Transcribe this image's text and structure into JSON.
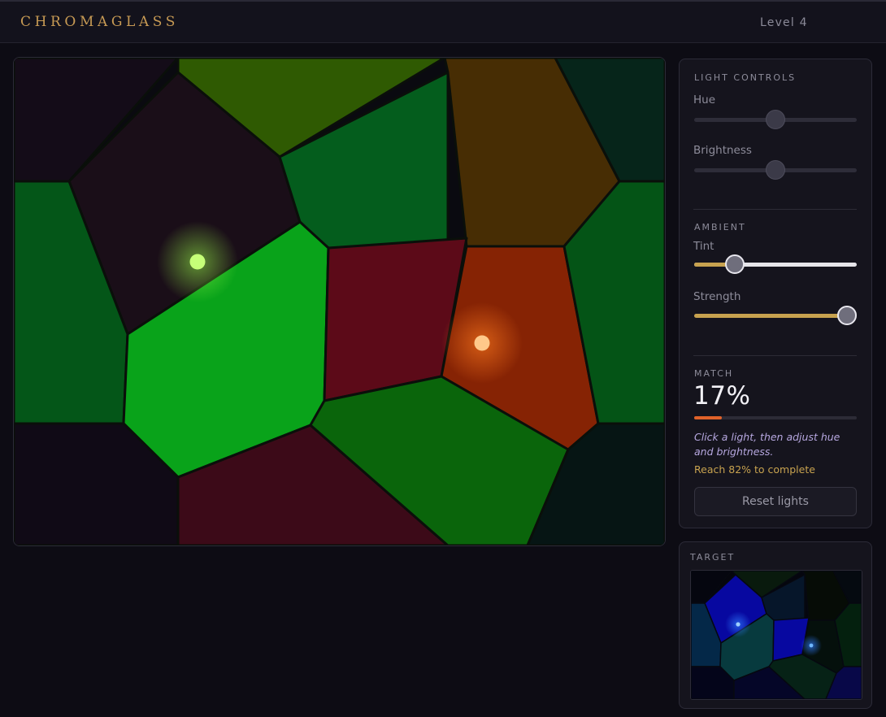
{
  "header": {
    "title": "CHROMAGLASS",
    "level": "Level 4"
  },
  "panel": {
    "light_controls_label": "LIGHT CONTROLS",
    "hue_label": "Hue",
    "hue_value": 0.5,
    "brightness_label": "Brightness",
    "brightness_value": 0.5,
    "ambient_label": "AMBIENT",
    "tint_label": "Tint",
    "tint_value": 0.25,
    "strength_label": "Strength",
    "strength_value": 0.94,
    "match_label": "MATCH",
    "match_value": "17%",
    "match_fraction": 0.17,
    "hint": "Click a light, then adjust hue and brightness.",
    "goal": "Reach 82% to complete",
    "reset_label": "Reset lights"
  },
  "target": {
    "label": "TARGET"
  },
  "colors": {
    "accent_gold": "#c7a24f",
    "match_orange": "#e0622a",
    "light_green": "#c6ff78",
    "light_orange": "#ffc98a",
    "target_light_blue": "#6fb6ff"
  },
  "lights": [
    {
      "name": "green-light",
      "color": "#c6ff78"
    },
    {
      "name": "orange-light",
      "color": "#ffc98a"
    }
  ],
  "target_lights": [
    {
      "name": "target-light-1",
      "color": "#6fb6ff"
    },
    {
      "name": "target-light-2",
      "color": "#6fb6ff"
    }
  ]
}
